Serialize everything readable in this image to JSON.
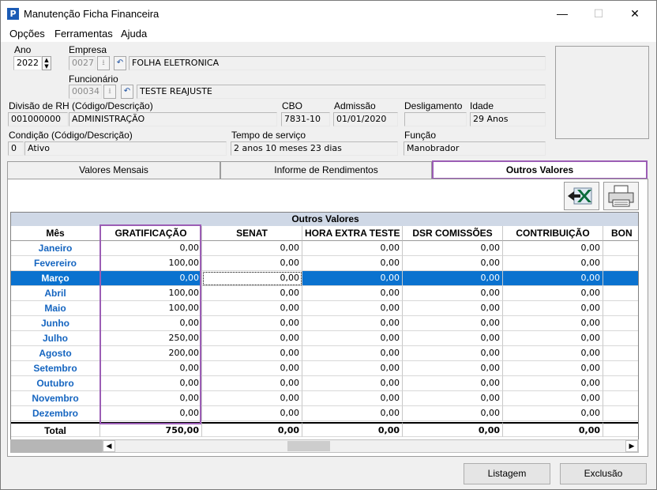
{
  "window": {
    "title": "Manutenção Ficha Financeira",
    "minimize": "—",
    "maximize": "☐",
    "close": "✕"
  },
  "menu": [
    "Opções",
    "Ferramentas",
    "Ajuda"
  ],
  "form": {
    "ano_label": "Ano",
    "ano_value": "2022",
    "empresa_label": "Empresa",
    "empresa_code": "0027",
    "empresa_name": "FOLHA ELETRONICA",
    "funcionario_label": "Funcionário",
    "funcionario_code": "00034",
    "funcionario_name": "TESTE REAJUSTE",
    "divisao_label": "Divisão de RH (Código/Descrição)",
    "divisao_code": "001000000",
    "divisao_desc": "ADMINISTRAÇÃO",
    "cbo_label": "CBO",
    "cbo_value": "7831-10",
    "admissao_label": "Admissão",
    "admissao_value": "01/01/2020",
    "desligamento_label": "Desligamento",
    "desligamento_value": "",
    "idade_label": "Idade",
    "idade_value": "29 Anos",
    "condicao_label": "Condição (Código/Descrição)",
    "condicao_code": "0",
    "condicao_desc": "Ativo",
    "tempo_label": "Tempo de serviço",
    "tempo_value": "2 anos 10 meses 23 dias",
    "funcao_label": "Função",
    "funcao_value": "Manobrador"
  },
  "tabs": [
    {
      "label": "Valores Mensais",
      "active": false
    },
    {
      "label": "Informe de Rendimentos",
      "active": false
    },
    {
      "label": "Outros Valores",
      "active": true
    }
  ],
  "grid": {
    "title": "Outros Valores",
    "columns": [
      "Mês",
      "GRATIFICAÇÃO",
      "SENAT",
      "HORA EXTRA TESTE",
      "DSR COMISSÕES",
      "CONTRIBUIÇÃO",
      "BON"
    ],
    "rows": [
      {
        "month": "Janeiro",
        "values": [
          "0,00",
          "0,00",
          "0,00",
          "0,00",
          "0,00"
        ]
      },
      {
        "month": "Fevereiro",
        "values": [
          "100,00",
          "0,00",
          "0,00",
          "0,00",
          "0,00"
        ]
      },
      {
        "month": "Março",
        "values": [
          "0,00",
          "0,00",
          "0,00",
          "0,00",
          "0,00"
        ],
        "selected": true
      },
      {
        "month": "Abril",
        "values": [
          "100,00",
          "0,00",
          "0,00",
          "0,00",
          "0,00"
        ]
      },
      {
        "month": "Maio",
        "values": [
          "100,00",
          "0,00",
          "0,00",
          "0,00",
          "0,00"
        ]
      },
      {
        "month": "Junho",
        "values": [
          "0,00",
          "0,00",
          "0,00",
          "0,00",
          "0,00"
        ]
      },
      {
        "month": "Julho",
        "values": [
          "250,00",
          "0,00",
          "0,00",
          "0,00",
          "0,00"
        ]
      },
      {
        "month": "Agosto",
        "values": [
          "200,00",
          "0,00",
          "0,00",
          "0,00",
          "0,00"
        ]
      },
      {
        "month": "Setembro",
        "values": [
          "0,00",
          "0,00",
          "0,00",
          "0,00",
          "0,00"
        ]
      },
      {
        "month": "Outubro",
        "values": [
          "0,00",
          "0,00",
          "0,00",
          "0,00",
          "0,00"
        ]
      },
      {
        "month": "Novembro",
        "values": [
          "0,00",
          "0,00",
          "0,00",
          "0,00",
          "0,00"
        ]
      },
      {
        "month": "Dezembro",
        "values": [
          "0,00",
          "0,00",
          "0,00",
          "0,00",
          "0,00"
        ]
      }
    ],
    "total": {
      "label": "Total",
      "values": [
        "750,00",
        "0,00",
        "0,00",
        "0,00",
        "0,00"
      ]
    }
  },
  "buttons": {
    "listagem": "Listagem",
    "exclusao": "Exclusão"
  },
  "colors": {
    "selection": "#0a72cf",
    "highlight": "#9b5db5",
    "month_text": "#1565c0"
  }
}
